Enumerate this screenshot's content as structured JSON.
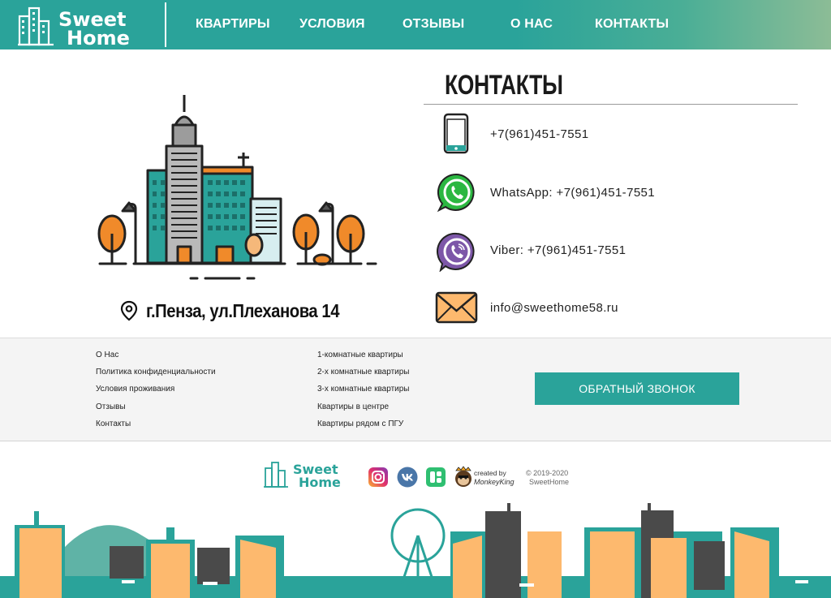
{
  "brand": {
    "logo_word1": "Sweet",
    "logo_word2": "Home"
  },
  "nav": {
    "items": [
      {
        "label": "КВАРТИРЫ"
      },
      {
        "label": "УСЛОВИЯ"
      },
      {
        "label": "ОТЗЫВЫ"
      },
      {
        "label": "О НАС"
      },
      {
        "label": "КОНТАКТЫ"
      }
    ]
  },
  "address": {
    "text": "г.Пенза, ул.Плеханова 14"
  },
  "contacts": {
    "title": "КОНТАКТЫ",
    "phone": "+7(961)451-7551",
    "whatsapp": "WhatsApp: +7(961)451-7551",
    "viber": "Viber: +7(961)451-7551",
    "email": "info@sweethome58.ru"
  },
  "footer": {
    "col1": [
      "О Нас",
      "Политика конфиденциальности",
      "Условия проживания",
      "Отзывы",
      "Контакты"
    ],
    "col2": [
      "1-комнатные квартиры",
      "2-х комнатные квартиры",
      "3-х комнатные квартиры",
      "Квартиры в центре",
      "Квартиры рядом с ПГУ"
    ],
    "callback_label": "ОБРАТНЫЙ ЗВОНОК"
  },
  "bottom": {
    "created_by": "created by",
    "creator": "MonkeyKing",
    "copyright_line1": "© 2019-2020",
    "copyright_line2": "SweetHome"
  },
  "colors": {
    "accent": "#2aa39a",
    "peach": "#fdb96e",
    "dark": "#4a4a4a"
  },
  "icons": [
    "location-pin-icon",
    "phone-icon",
    "whatsapp-icon",
    "viber-icon",
    "mail-icon",
    "instagram-icon",
    "vk-icon",
    "booking-icon"
  ]
}
